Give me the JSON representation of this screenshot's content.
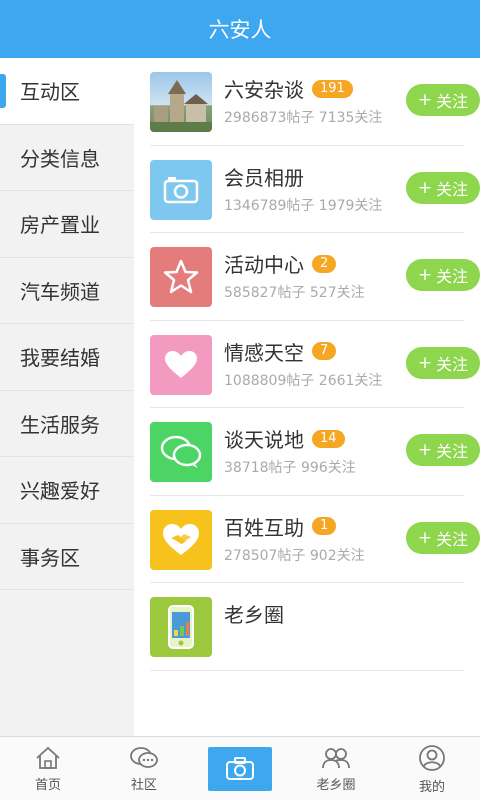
{
  "header": {
    "title": "六安人"
  },
  "sidebar": {
    "items": [
      {
        "label": "互动区"
      },
      {
        "label": "分类信息"
      },
      {
        "label": "房产置业"
      },
      {
        "label": "汽车频道"
      },
      {
        "label": "我要结婚"
      },
      {
        "label": "生活服务"
      },
      {
        "label": "兴趣爱好"
      },
      {
        "label": "事务区"
      }
    ],
    "active_index": 0
  },
  "forums": [
    {
      "title": "六安杂谈",
      "badge": "191",
      "stats": "2986873帖子 7135关注",
      "follow_label": "关注",
      "icon": "building-photo-icon"
    },
    {
      "title": "会员相册",
      "badge": "",
      "stats": "1346789帖子 1979关注",
      "follow_label": "关注",
      "icon": "camera-icon",
      "color": "#7ec8f0"
    },
    {
      "title": "活动中心",
      "badge": "2",
      "stats": "585827帖子 527关注",
      "follow_label": "关注",
      "icon": "star-icon",
      "color": "#e57c7c"
    },
    {
      "title": "情感天空",
      "badge": "7",
      "stats": "1088809帖子 2661关注",
      "follow_label": "关注",
      "icon": "heart-icon",
      "color": "#f29ac0"
    },
    {
      "title": "谈天说地",
      "badge": "14",
      "stats": "38718帖子 996关注",
      "follow_label": "关注",
      "icon": "chat-bubbles-icon",
      "color": "#4cd464"
    },
    {
      "title": "百姓互助",
      "badge": "1",
      "stats": "278507帖子 902关注",
      "follow_label": "关注",
      "icon": "handshake-heart-icon",
      "color": "#f7c21c"
    },
    {
      "title": "老乡圈",
      "badge": "",
      "stats": "",
      "follow_label": "",
      "icon": "phone-app-icon",
      "color": "#9bc83c"
    }
  ],
  "tabbar": {
    "items": [
      {
        "label": "首页",
        "icon": "home-icon"
      },
      {
        "label": "社区",
        "icon": "community-icon"
      },
      {
        "label": "",
        "icon": "camera-icon"
      },
      {
        "label": "老乡圈",
        "icon": "people-icon"
      },
      {
        "label": "我的",
        "icon": "user-icon"
      }
    ]
  },
  "colors": {
    "primary": "#3da7f0",
    "follow": "#8fd64f",
    "badge": "#f5a623"
  }
}
